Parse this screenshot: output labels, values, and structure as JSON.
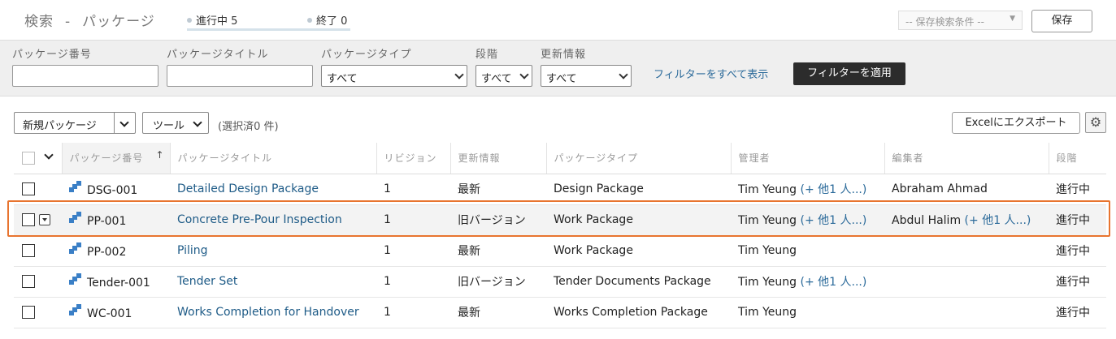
{
  "header": {
    "breadcrumb_search": "検索",
    "breadcrumb_sep": "-",
    "breadcrumb_current": "パッケージ",
    "status_tabs": [
      {
        "label": "進行中 5"
      },
      {
        "label": "終了 0"
      }
    ],
    "saved_search_placeholder": "-- 保存検索条件 --",
    "save_label": "保存"
  },
  "filters": {
    "package_number_label": "パッケージ番号",
    "package_title_label": "パッケージタイトル",
    "package_type_label": "パッケージタイプ",
    "package_type_value": "すべて",
    "stage_label": "段階",
    "stage_value": "すべて",
    "update_label": "更新情報",
    "update_value": "すべて",
    "show_all_label": "フィルターをすべて表示",
    "apply_label": "フィルターを適用"
  },
  "toolbar": {
    "new_package_label": "新規パッケージ",
    "tools_label": "ツール",
    "selected_count": "(選択済0 件)",
    "export_label": "Excelにエクスポート"
  },
  "table": {
    "columns": [
      "パッケージ番号",
      "パッケージタイトル",
      "リビジョン",
      "更新情報",
      "パッケージタイプ",
      "管理者",
      "編集者",
      "段階"
    ],
    "rows": [
      {
        "number": "DSG-001",
        "title": "Detailed Design Package",
        "revision": "1",
        "update": "最新",
        "type": "Design Package",
        "manager": "Tim Yeung",
        "manager_more": "(+ 他1 人...)",
        "editor": "Abraham Ahmad",
        "editor_more": "",
        "stage": "進行中"
      },
      {
        "number": "PP-001",
        "title": "Concrete Pre-Pour Inspection",
        "revision": "1",
        "update": "旧バージョン",
        "type": "Work Package",
        "manager": "Tim Yeung",
        "manager_more": "(+ 他1 人...)",
        "editor": "Abdul Halim",
        "editor_more": "(+ 他1 人...)",
        "stage": "進行中"
      },
      {
        "number": "PP-002",
        "title": "Piling",
        "revision": "1",
        "update": "最新",
        "type": "Work Package",
        "manager": "Tim Yeung",
        "manager_more": "",
        "editor": "",
        "editor_more": "",
        "stage": "進行中"
      },
      {
        "number": "Tender-001",
        "title": "Tender Set",
        "revision": "1",
        "update": "旧バージョン",
        "type": "Tender Documents Package",
        "manager": "Tim Yeung",
        "manager_more": "(+ 他1 人...)",
        "editor": "",
        "editor_more": "",
        "stage": "進行中"
      },
      {
        "number": "WC-001",
        "title": "Works Completion for Handover",
        "revision": "1",
        "update": "最新",
        "type": "Works Completion Package",
        "manager": "Tim Yeung",
        "manager_more": "",
        "editor": "",
        "editor_more": "",
        "stage": "進行中"
      }
    ]
  },
  "colors": {
    "link": "#1e5b87",
    "highlight": "#e8742f",
    "icon": "#3a7fc6"
  }
}
